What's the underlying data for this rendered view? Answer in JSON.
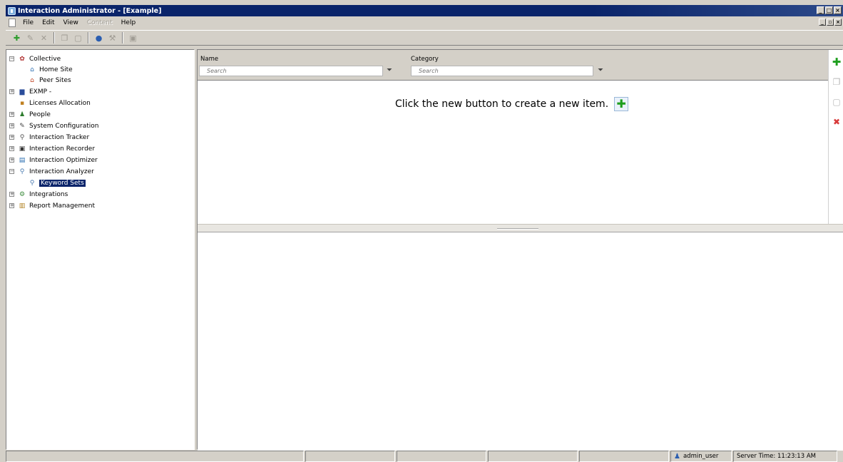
{
  "window": {
    "title": "Interaction Administrator - [Example]"
  },
  "menu": {
    "items": [
      {
        "label": "File",
        "disabled": false
      },
      {
        "label": "Edit",
        "disabled": false
      },
      {
        "label": "View",
        "disabled": false
      },
      {
        "label": "Content",
        "disabled": true
      },
      {
        "label": "Help",
        "disabled": false
      }
    ]
  },
  "tree": {
    "collective": "Collective",
    "home_site": "Home Site",
    "peer_sites": "Peer Sites",
    "server": "EXMP -",
    "licenses": "Licenses Allocation",
    "people": "People",
    "system_configuration": "System Configuration",
    "interaction_tracker": "Interaction Tracker",
    "interaction_recorder": "Interaction Recorder",
    "interaction_optimizer": "Interaction Optimizer",
    "interaction_analyzer": "Interaction Analyzer",
    "keyword_sets": "Keyword Sets",
    "integrations": "Integrations",
    "report_management": "Report Management"
  },
  "grid": {
    "columns": {
      "name": "Name",
      "category": "Category"
    },
    "name_search_placeholder": "Search",
    "category_search_placeholder": "Search",
    "empty_message": "Click the new button to create a new item."
  },
  "status": {
    "user": "admin_user",
    "server_time": "Server Time: 11:23:13 AM"
  },
  "colors": {
    "titlebar": "#0a246a",
    "selection": "#0a246a",
    "add_green": "#1e9e1e",
    "delete_red": "#d83a3a"
  }
}
